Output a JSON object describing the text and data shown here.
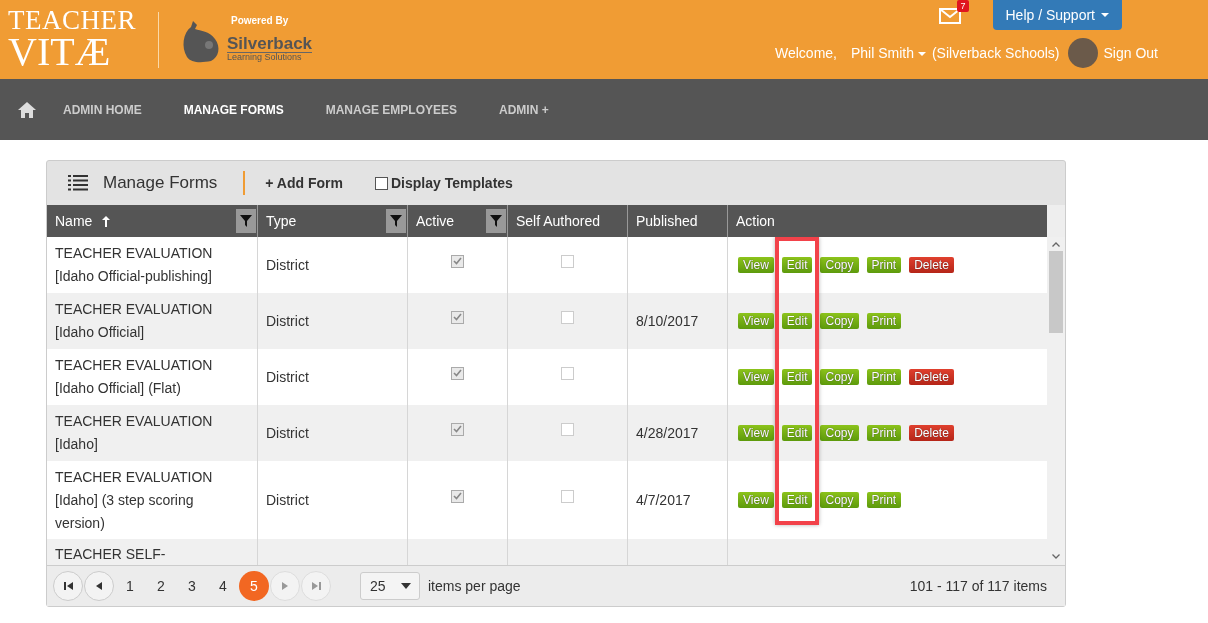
{
  "header": {
    "logo_line1": "TEACHER",
    "logo_line2": "VITÆ",
    "powered_by": "Powered By",
    "partner_name": "Silverback",
    "partner_sub": "Learning Solutions",
    "mail_count": "7",
    "help_button": "Help / Support",
    "welcome": "Welcome,",
    "user": "Phil Smith",
    "organization": "(Silverback Schools)",
    "sign_out": "Sign Out"
  },
  "nav": [
    {
      "label": "ADMIN HOME",
      "selected": false
    },
    {
      "label": "MANAGE FORMS",
      "selected": true
    },
    {
      "label": "MANAGE EMPLOYEES",
      "selected": false
    },
    {
      "label": "ADMIN +",
      "selected": false
    }
  ],
  "panel": {
    "title": "Manage Forms",
    "add_button": "+ Add Form",
    "display_templates": {
      "label": "Display Templates",
      "checked": false
    }
  },
  "table": {
    "columns": [
      {
        "label": "Name",
        "sorted": true,
        "filter": true
      },
      {
        "label": "Type",
        "sorted": false,
        "filter": true
      },
      {
        "label": "Active",
        "sorted": false,
        "filter": true
      },
      {
        "label": "Self Authored",
        "sorted": false,
        "filter": false
      },
      {
        "label": "Published",
        "sorted": false,
        "filter": false
      },
      {
        "label": "Action",
        "sorted": false,
        "filter": false
      }
    ],
    "rows": [
      {
        "name": [
          "TEACHER EVALUATION",
          "[Idaho Official-publishing]"
        ],
        "type": "District",
        "active": true,
        "self_authored": false,
        "published": "",
        "actions": [
          {
            "label": "View",
            "kind": "view"
          },
          {
            "label": "Edit",
            "kind": "edit"
          },
          {
            "label": "Copy",
            "kind": "copy"
          },
          {
            "label": "Print",
            "kind": "print"
          },
          {
            "label": "Delete",
            "kind": "delete"
          }
        ]
      },
      {
        "name": [
          "TEACHER EVALUATION",
          "[Idaho Official]"
        ],
        "type": "District",
        "active": true,
        "self_authored": false,
        "published": "8/10/2017",
        "actions": [
          {
            "label": "View",
            "kind": "view"
          },
          {
            "label": "Edit",
            "kind": "edit"
          },
          {
            "label": "Copy",
            "kind": "copy"
          },
          {
            "label": "Print",
            "kind": "print"
          }
        ]
      },
      {
        "name": [
          "TEACHER EVALUATION",
          "[Idaho Official] (Flat)"
        ],
        "type": "District",
        "active": true,
        "self_authored": false,
        "published": "",
        "actions": [
          {
            "label": "View",
            "kind": "view"
          },
          {
            "label": "Edit",
            "kind": "edit"
          },
          {
            "label": "Copy",
            "kind": "copy"
          },
          {
            "label": "Print",
            "kind": "print"
          },
          {
            "label": "Delete",
            "kind": "delete"
          }
        ]
      },
      {
        "name": [
          "TEACHER EVALUATION",
          "[Idaho]"
        ],
        "type": "District",
        "active": true,
        "self_authored": false,
        "published": "4/28/2017",
        "actions": [
          {
            "label": "View",
            "kind": "view"
          },
          {
            "label": "Edit",
            "kind": "edit"
          },
          {
            "label": "Copy",
            "kind": "copy"
          },
          {
            "label": "Print",
            "kind": "print"
          },
          {
            "label": "Delete",
            "kind": "delete"
          }
        ]
      },
      {
        "name": [
          "TEACHER EVALUATION",
          "[Idaho] (3 step scoring",
          "version)"
        ],
        "type": "District",
        "active": true,
        "self_authored": false,
        "published": "4/7/2017",
        "actions": [
          {
            "label": "View",
            "kind": "view"
          },
          {
            "label": "Edit",
            "kind": "edit"
          },
          {
            "label": "Copy",
            "kind": "copy"
          },
          {
            "label": "Print",
            "kind": "print"
          }
        ]
      },
      {
        "name": [
          "TEACHER SELF-"
        ],
        "partial": true
      }
    ]
  },
  "pager": {
    "pages": [
      {
        "label": "1",
        "selected": false
      },
      {
        "label": "2",
        "selected": false
      },
      {
        "label": "3",
        "selected": false
      },
      {
        "label": "4",
        "selected": false
      },
      {
        "label": "5",
        "selected": true
      }
    ],
    "next_disabled": true,
    "page_size": "25",
    "page_size_label": "items per page",
    "summary": "101 - 117 of 117 items"
  }
}
